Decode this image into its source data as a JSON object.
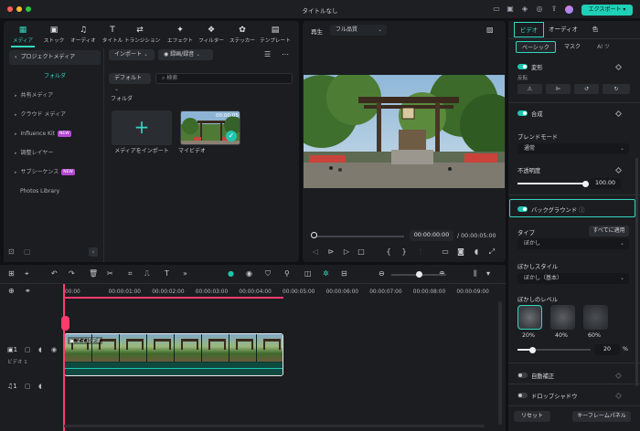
{
  "window": {
    "title": "タイトルなし",
    "export_label": "エクスポート ▾"
  },
  "media_tabs": [
    {
      "label": "メディア",
      "icon": "media-icon",
      "glyph": "▦"
    },
    {
      "label": "ストック",
      "icon": "stock-icon",
      "glyph": "▣"
    },
    {
      "label": "オーディオ",
      "icon": "music-icon",
      "glyph": "♫"
    },
    {
      "label": "タイトル",
      "icon": "title-icon",
      "glyph": "T"
    },
    {
      "label": "トランジション",
      "icon": "transition-icon",
      "glyph": "⇄"
    },
    {
      "label": "エフェクト",
      "icon": "effect-icon",
      "glyph": "✦"
    },
    {
      "label": "フィルター",
      "icon": "filter-icon",
      "glyph": "❖"
    },
    {
      "label": "ステッカー",
      "icon": "sticker-icon",
      "glyph": "✿"
    },
    {
      "label": "テンプレート",
      "icon": "template-icon",
      "glyph": "▤"
    }
  ],
  "sidebar": {
    "header": "プロジェクトメディア",
    "selected": "フォルダ",
    "items": [
      {
        "label": "共有メディア",
        "badge": ""
      },
      {
        "label": "クラウド メディア",
        "badge": ""
      },
      {
        "label": "Influence Kit",
        "badge": "NEW"
      },
      {
        "label": "調整レイヤー",
        "badge": ""
      },
      {
        "label": "サブシーケンス",
        "badge": "NEW"
      },
      {
        "label": "Photos Library",
        "badge": ""
      }
    ]
  },
  "media_toolbar": {
    "import_label": "インポート",
    "record_label": "録画/録音",
    "sort_label": "デフォルト",
    "search_placeholder": "検索",
    "folder_label": "フォルダ"
  },
  "media_items": {
    "import_caption": "メディアをインポート",
    "video_caption": "マイビデオ",
    "video_duration": "00:00:05"
  },
  "player": {
    "label": "再生",
    "quality": "フル品質",
    "current_time": "00:00:00:00",
    "total_time": "/ 00:00:05:00",
    "progress": 0
  },
  "timeline": {
    "ticks": [
      "00:00",
      "00:00:01:00",
      "00:00:02:00",
      "00:00:03:00",
      "00:00:04:00",
      "00:00:05:00",
      "00:00:06:00",
      "00:00:07:00",
      "00:00:08:00",
      "00:00:09:00"
    ],
    "clip_label": "マイビデオ",
    "video_track_label": "ビデオ 1",
    "video_track_num": "1",
    "audio_track_num": "1"
  },
  "right_panel": {
    "tabs": [
      "ビデオ",
      "オーディオ",
      "色"
    ],
    "sub_tabs": [
      "ベーシック",
      "マスク",
      "AI ツ"
    ],
    "transform_label": "変形",
    "flip_label": "反転",
    "composite_label": "合成",
    "blend_mode_label": "ブレンドモード",
    "blend_mode_value": "通常",
    "opacity_label": "不透明度",
    "opacity_value": "100.00",
    "opacity": 100,
    "background_label": "バックグラウンド",
    "type_label": "タイプ",
    "apply_all_label": "すべてに適用",
    "type_value": "ぼかし",
    "blur_style_label": "ぼかしスタイル",
    "blur_style_value": "ぼかし（基本）",
    "blur_level_label": "ぼかしのレベル",
    "blur_levels": [
      "20%",
      "40%",
      "60%"
    ],
    "blur_value": "20",
    "blur_unit": "%",
    "blur_level": 20,
    "auto_enhance_label": "自動補正",
    "drop_shadow_label": "ドロップシャドウ",
    "reset_label": "リセット",
    "keyframe_label": "キーフレームパネル"
  },
  "colors": {
    "accent": "#33d6c0",
    "playhead": "#ff3b6b",
    "badge": "#b548d4"
  }
}
